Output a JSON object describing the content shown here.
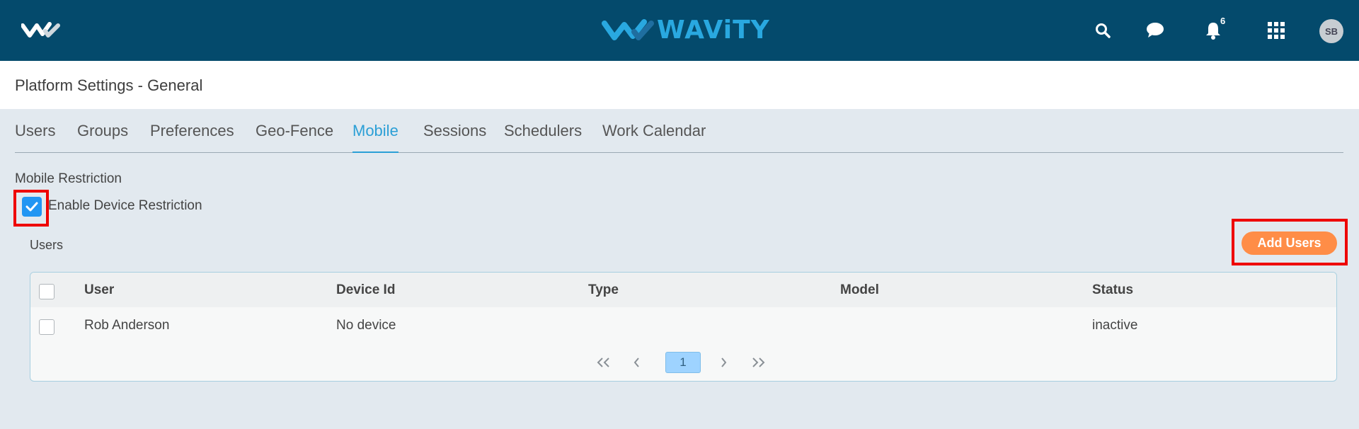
{
  "header": {
    "brand_name": "WAViTY",
    "notification_count": "6",
    "avatar_initials": "SB",
    "icons": [
      "logo-icon",
      "search-icon",
      "chat-icon",
      "bell-icon",
      "apps-grid-icon"
    ],
    "colors": {
      "bar": "#044a6c",
      "brand": "#29a8e0"
    }
  },
  "page": {
    "title": "Platform Settings - General"
  },
  "tabs": [
    {
      "label": "Users"
    },
    {
      "label": "Groups"
    },
    {
      "label": "Preferences"
    },
    {
      "label": "Geo-Fence"
    },
    {
      "label": "Mobile",
      "active": true
    },
    {
      "label": "Sessions"
    },
    {
      "label": "Schedulers"
    },
    {
      "label": "Work Calendar"
    }
  ],
  "mobile": {
    "section_title": "Mobile Restriction",
    "enable_label": "Enable Device Restriction",
    "enable_checked": true,
    "users_label": "Users",
    "add_users_label": "Add Users"
  },
  "table": {
    "columns": [
      "User",
      "Device Id",
      "Type",
      "Model",
      "Status"
    ],
    "rows": [
      {
        "user": "Rob Anderson",
        "device_id": "No device",
        "type": "",
        "model": "",
        "status": "inactive"
      }
    ]
  },
  "pagination": {
    "first": "«",
    "prev": "‹",
    "current": "1",
    "next": "›",
    "last": "»"
  },
  "accent_colors": {
    "active_tab": "#2b9fd6",
    "add_button": "#ff8d47",
    "highlight": "#ee0000"
  }
}
